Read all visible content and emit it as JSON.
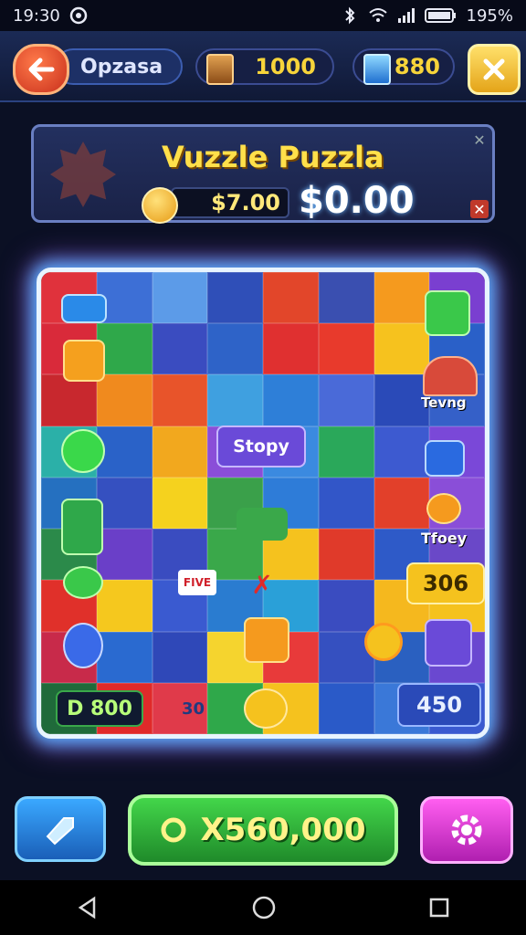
{
  "status_bar": {
    "time": "19:30",
    "battery": "195%"
  },
  "header": {
    "title": "Opzasa",
    "coins": "1000",
    "gems": "880"
  },
  "banner": {
    "title": "Vuzzle Puzzla",
    "bar_value": "$7.00",
    "amount": "$0.00"
  },
  "board": {
    "center_label": "Stopy",
    "right_label_1": "Tevng",
    "right_label_2": "Tfoey",
    "score_right": "306",
    "bottom_left_score": "D 800",
    "bottom_right_score": "450",
    "tile_small": "30",
    "tile_word": "FIVE"
  },
  "bottom": {
    "main_value": "X560,000"
  },
  "colors": {
    "accent_yellow": "#ffe04a",
    "green_button": "#43d64a",
    "blue_button": "#3aa8ff",
    "pink_button": "#ff5ef0"
  }
}
